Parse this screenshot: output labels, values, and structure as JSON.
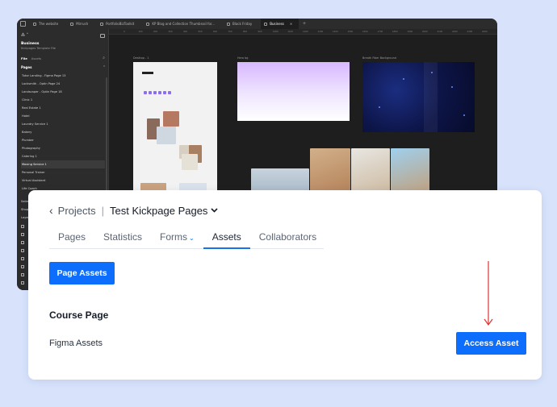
{
  "figma": {
    "tabs": [
      {
        "label": "The website",
        "active": false
      },
      {
        "label": "Mirrush",
        "active": false
      },
      {
        "label": "PortfolioBizToolkit",
        "active": false
      },
      {
        "label": "KP Blog and Collection Thumbnail for...",
        "active": false
      },
      {
        "label": "Black Friday",
        "active": false
      },
      {
        "label": "Business",
        "active": true
      }
    ],
    "file_name": "Business",
    "file_sub": "Kickpages Template File",
    "panel_tabs": {
      "file": "File",
      "assets": "Assets"
    },
    "pages_header": "Pages",
    "pages": [
      "Tutor Landing - Figma Page 13",
      "Locksmith - Optin Page 24",
      "Landscaper - Optin Page 18",
      "Clinic 1",
      "Real Estate 1",
      "Hotel",
      "Laundry Service 1",
      "Bakery",
      "Plumber",
      "Photography",
      "Catering 1",
      "Moving Service 1",
      "Personal Trainer",
      "Virtual Assistant",
      "Life Coach"
    ],
    "selected_page": "Moving Service 1",
    "truncated_items": [
      "Sales",
      "Shop",
      "Layers"
    ],
    "ruler_ticks": [
      "0",
      "100",
      "200",
      "300",
      "400",
      "500",
      "600",
      "700",
      "800",
      "900",
      "1000",
      "1100",
      "1200",
      "1300",
      "1400",
      "1500",
      "1600",
      "1700",
      "1800",
      "1900",
      "2000",
      "2100",
      "2200",
      "2300",
      "2400"
    ],
    "frame_labels": [
      "Desktop - 1",
      "Hero bg",
      "Breath Fiber Background"
    ],
    "colors": {
      "frame_bg": "#1e1e1e",
      "panel_bg": "#2c2c2c"
    }
  },
  "card": {
    "breadcrumb": {
      "back_icon": "chevron-left-icon",
      "projects": "Projects",
      "separator": "|",
      "title": "Test Kickpage Pages",
      "title_icon": "chevron-down-icon"
    },
    "tabs": [
      {
        "label": "Pages",
        "active": false
      },
      {
        "label": "Statistics",
        "active": false
      },
      {
        "label": "Forms",
        "active": false,
        "has_dropdown": true
      },
      {
        "label": "Assets",
        "active": true
      },
      {
        "label": "Collaborators",
        "active": false
      }
    ],
    "page_assets_button": "Page Assets",
    "section_title": "Course Page",
    "asset_row": {
      "label": "Figma Assets",
      "button": "Access Asset"
    },
    "colors": {
      "primary": "#0d6efd",
      "tab_underline": "#1973e8",
      "arrow": "#e0312d"
    }
  }
}
